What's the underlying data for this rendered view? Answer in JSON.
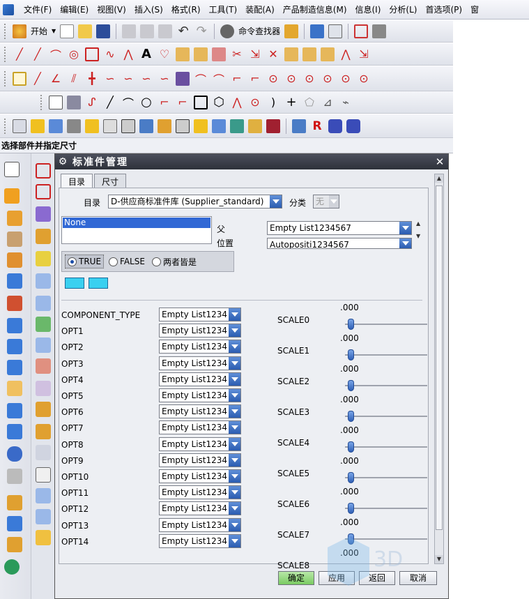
{
  "menu": [
    "文件(F)",
    "编辑(E)",
    "视图(V)",
    "插入(S)",
    "格式(R)",
    "工具(T)",
    "装配(A)",
    "产品制造信息(M)",
    "信息(I)",
    "分析(L)",
    "首选项(P)",
    "窗"
  ],
  "toolbar": {
    "start_label": "开始",
    "command_finder_label": "命令查找器"
  },
  "status_prompt": "选择部件并指定尺寸",
  "dialog": {
    "title": "标准件管理",
    "close": "✕",
    "tabs": [
      "目录",
      "尺寸"
    ],
    "catalog_label": "目录",
    "catalog_value": "D-供应商标准件库 (Supplier_standard)",
    "category_label": "分类",
    "category_value": "无",
    "list_selected": "None",
    "parent_label": "父",
    "parent_value": "Empty List1234567",
    "position_label": "位置",
    "position_value": "Autopositi1234567",
    "radios": [
      "TRUE",
      "FALSE",
      "两者皆是"
    ],
    "params": [
      {
        "name": "COMPONENT_TYPE",
        "value": "Empty List1234"
      },
      {
        "name": "OPT1",
        "value": "Empty List1234"
      },
      {
        "name": "OPT2",
        "value": "Empty List1234"
      },
      {
        "name": "OPT3",
        "value": "Empty List1234"
      },
      {
        "name": "OPT4",
        "value": "Empty List1234"
      },
      {
        "name": "OPT5",
        "value": "Empty List1234"
      },
      {
        "name": "OPT6",
        "value": "Empty List1234"
      },
      {
        "name": "OPT7",
        "value": "Empty List1234"
      },
      {
        "name": "OPT8",
        "value": "Empty List1234"
      },
      {
        "name": "OPT9",
        "value": "Empty List1234"
      },
      {
        "name": "OPT10",
        "value": "Empty List1234"
      },
      {
        "name": "OPT11",
        "value": "Empty List1234"
      },
      {
        "name": "OPT12",
        "value": "Empty List1234"
      },
      {
        "name": "OPT13",
        "value": "Empty List1234"
      },
      {
        "name": "OPT14",
        "value": "Empty List1234"
      }
    ],
    "scales": [
      {
        "name": "SCALE0",
        "value": ".000"
      },
      {
        "name": "SCALE1",
        "value": ".000"
      },
      {
        "name": "SCALE2",
        "value": ".000"
      },
      {
        "name": "SCALE3",
        "value": ".000"
      },
      {
        "name": "SCALE4",
        "value": ".000"
      },
      {
        "name": "SCALE5",
        "value": ".000"
      },
      {
        "name": "SCALE6",
        "value": ".000"
      },
      {
        "name": "SCALE7",
        "value": ".000"
      },
      {
        "name": "SCALE8",
        "value": ".000"
      }
    ],
    "buttons": {
      "ok": "确定",
      "apply": "应用",
      "back": "返回",
      "cancel": "取消"
    }
  },
  "colors": {
    "accent": "#2b5cb0",
    "title_bar": "#2e313a",
    "ok_button": "#7acb62"
  }
}
